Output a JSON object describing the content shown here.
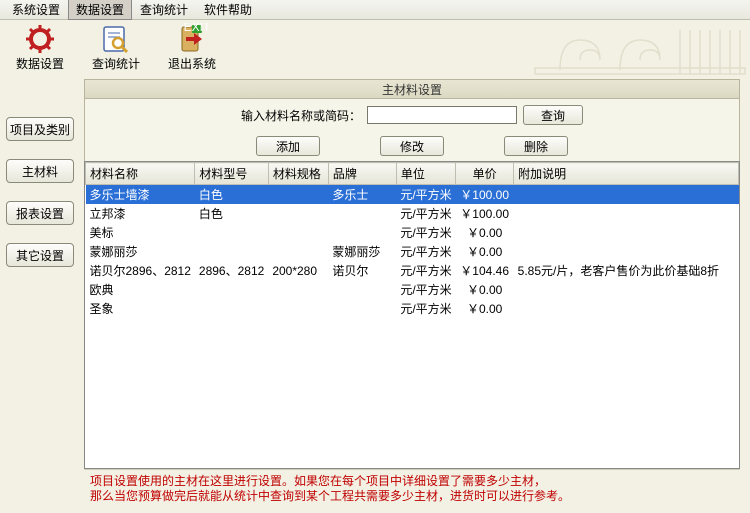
{
  "menu": {
    "items": [
      "系统设置",
      "数据设置",
      "查询统计",
      "软件帮助"
    ],
    "active_index": 1
  },
  "toolbar": {
    "items": [
      {
        "label": "数据设置",
        "icon": "gear-icon"
      },
      {
        "label": "查询统计",
        "icon": "search-icon"
      },
      {
        "label": "退出系统",
        "icon": "exit-icon"
      }
    ]
  },
  "sidebar": {
    "items": [
      {
        "label": "项目及类别"
      },
      {
        "label": "主材料"
      },
      {
        "label": "报表设置"
      },
      {
        "label": "其它设置"
      }
    ]
  },
  "panel": {
    "title": "主材料设置",
    "search_label": "输入材料名称或简码：",
    "search_value": "",
    "search_btn": "查询",
    "add_btn": "添加",
    "edit_btn": "修改",
    "del_btn": "删除"
  },
  "table": {
    "headers": [
      "材料名称",
      "材料型号",
      "材料规格",
      "品牌",
      "单位",
      "单价",
      "附加说明"
    ],
    "rows": [
      {
        "name": "多乐士墙漆",
        "model": "白色",
        "spec": "",
        "brand": "多乐士",
        "unit": "元/平方米",
        "price": "￥100.00",
        "note": "",
        "selected": true
      },
      {
        "name": "立邦漆",
        "model": "白色",
        "spec": "",
        "brand": "",
        "unit": "元/平方米",
        "price": "￥100.00",
        "note": ""
      },
      {
        "name": "美标",
        "model": "",
        "spec": "",
        "brand": "",
        "unit": "元/平方米",
        "price": "￥0.00",
        "note": ""
      },
      {
        "name": "蒙娜丽莎",
        "model": "",
        "spec": "",
        "brand": "蒙娜丽莎",
        "unit": "元/平方米",
        "price": "￥0.00",
        "note": ""
      },
      {
        "name": "诺贝尔2896、2812",
        "model": "2896、2812",
        "spec": "200*280",
        "brand": "诺贝尔",
        "unit": "元/平方米",
        "price": "￥104.46",
        "note": "5.85元/片，老客户售价为此价基础8折"
      },
      {
        "name": "欧典",
        "model": "",
        "spec": "",
        "brand": "",
        "unit": "元/平方米",
        "price": "￥0.00",
        "note": ""
      },
      {
        "name": "圣象",
        "model": "",
        "spec": "",
        "brand": "",
        "unit": "元/平方米",
        "price": "￥0.00",
        "note": ""
      }
    ]
  },
  "footer": {
    "line1": "项目设置使用的主材在这里进行设置。如果您在每个项目中详细设置了需要多少主材，",
    "line2": "那么当您预算做完后就能从统计中查询到某个工程共需要多少主材，进货时可以进行参考。"
  }
}
